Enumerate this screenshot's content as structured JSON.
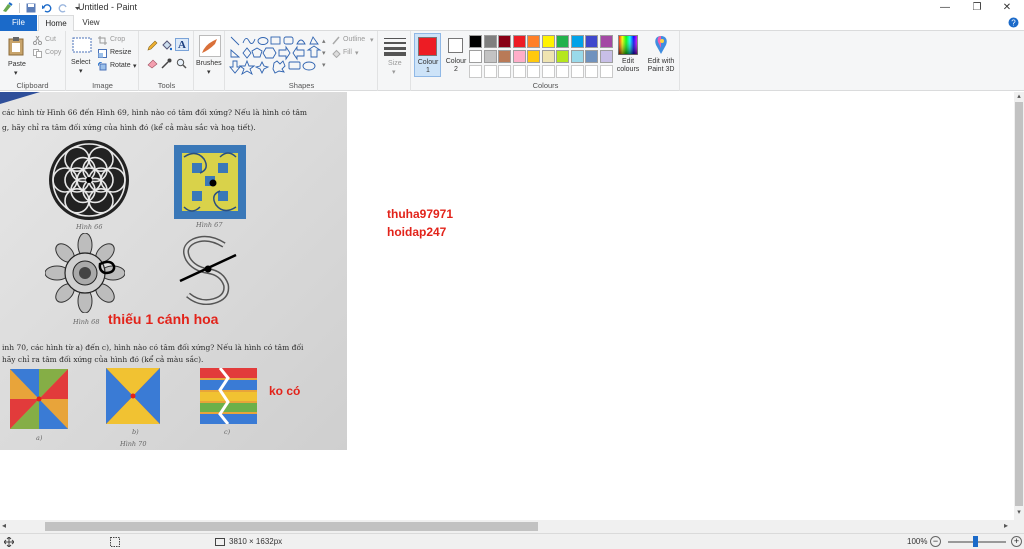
{
  "window": {
    "title": "Untitled - Paint",
    "minimize_glyph": "—",
    "maximize_glyph": "❐",
    "close_glyph": "✕"
  },
  "tabs": [
    {
      "label": "File"
    },
    {
      "label": "Home"
    },
    {
      "label": "View"
    }
  ],
  "ribbon": {
    "clipboard": {
      "paste": "Paste",
      "cut": "Cut",
      "copy": "Copy",
      "group": "Clipboard"
    },
    "image": {
      "select": "Select",
      "crop": "Crop",
      "resize": "Resize",
      "rotate": "Rotate",
      "group": "Image"
    },
    "tools": {
      "group": "Tools"
    },
    "brushes": {
      "label": "Brushes"
    },
    "shapes": {
      "outline": "Outline",
      "fill": "Fill",
      "group": "Shapes"
    },
    "size": {
      "label": "Size"
    },
    "colours": {
      "colour1": "Colour 1",
      "colour2": "Colour 2",
      "edit": "Edit colours",
      "paint3d": "Edit with Paint 3D",
      "group": "Colours",
      "colour1_value": "#ed1c24",
      "colour2_value": "#ffffff",
      "palette_row1": [
        "#000000",
        "#7f7f7f",
        "#880015",
        "#ed1c24",
        "#ff7f27",
        "#fff200",
        "#22b14c",
        "#00a2e8",
        "#3f48cc",
        "#a349a4"
      ],
      "palette_row2": [
        "#ffffff",
        "#c3c3c3",
        "#b97a57",
        "#ffaec9",
        "#ffc90e",
        "#efe4b0",
        "#b5e61d",
        "#99d9ea",
        "#7092be",
        "#c8bfe7"
      ],
      "palette_row3": [
        "#ffffff",
        "#ffffff",
        "#ffffff",
        "#ffffff",
        "#ffffff",
        "#ffffff",
        "#ffffff",
        "#ffffff",
        "#ffffff",
        "#ffffff"
      ]
    }
  },
  "canvas": {
    "photo_text_line1": "các hình từ Hình 66 đến Hình 69, hình nào có tâm đối xứng? Nếu là hình có tâm",
    "photo_text_line2": "g, hãy chỉ ra tâm đối xứng của hình đó (kể cả màu sắc và hoạ tiết).",
    "caption_66": "Hình 66",
    "caption_67": "Hình 67",
    "caption_68": "Hình 68",
    "photo_text_line3": "inh 70, các hình từ a) đến c), hình nào có tâm đối xứng? Nếu là hình có tâm đối",
    "photo_text_line4": "hãy chỉ ra tâm đối xứng của hình đó (kể cả màu sắc).",
    "caption_a": "a)",
    "caption_b": "b)",
    "caption_c": "c)",
    "caption_70": "Hình 70",
    "note_missing_petal": "thiếu 1 cánh hoa",
    "note_no": "ko có",
    "username": "thuha97971",
    "site": "hoidap247"
  },
  "status": {
    "dimensions": "3810 × 1632px",
    "zoom": "100%"
  },
  "icons": [
    "quick-access-icons",
    "paste-icon",
    "cut-icon",
    "copy-icon",
    "select-icon",
    "crop-icon",
    "resize-icon",
    "rotate-icon",
    "pencil-icon",
    "fill-icon",
    "text-icon",
    "eraser-icon",
    "color-picker-icon",
    "magnifier-icon",
    "brushes-icon",
    "size-icon",
    "edit-colours-icon",
    "paint3d-icon"
  ]
}
